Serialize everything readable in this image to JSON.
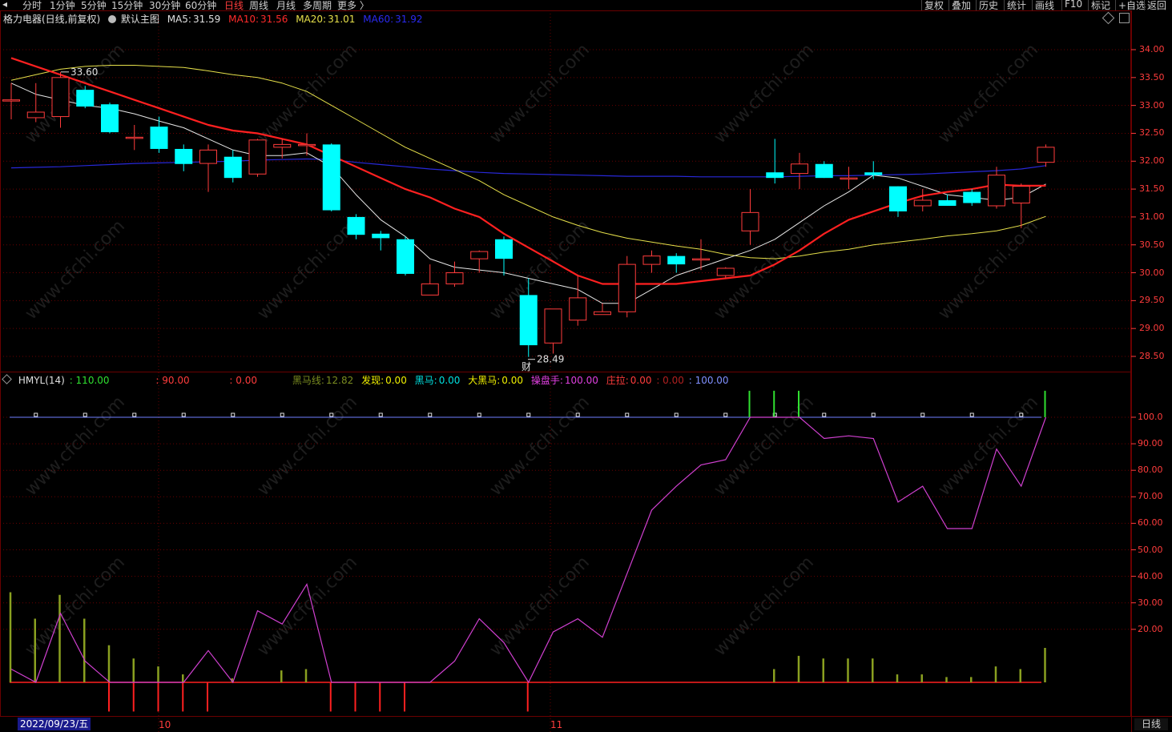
{
  "toolbar": {
    "periods": [
      "分时",
      "1分钟",
      "5分钟",
      "15分钟",
      "30分钟",
      "60分钟",
      "日线",
      "周线",
      "月线",
      "多周期",
      "更多 〉"
    ],
    "active_period": "日线",
    "right_buttons": [
      "复权",
      "叠加",
      "历史",
      "统计",
      "画线",
      "F10",
      "标记",
      "+自选",
      "返回"
    ]
  },
  "main_legend": {
    "title": "格力电器(日线,前复权)",
    "template": "默认主图",
    "ma5_label": "MA5:",
    "ma5_value": "31.59",
    "ma10_label": "MA10:",
    "ma10_value": "31.56",
    "ma20_label": "MA20:",
    "ma20_value": "31.01",
    "ma60_label": "MA60:",
    "ma60_value": "31.92"
  },
  "indicator_legend": {
    "name": "HMYL(14)",
    "v1": ": 110.00",
    "v2": ": 90.00",
    "v3": ": 0.00",
    "heima_line_label": "黑马线:",
    "heima_line_value": "12.82",
    "faxian_label": "发现:",
    "faxian_value": "0.00",
    "heima_label": "黑马:",
    "heima_value": "0.00",
    "daheima_label": "大黑马:",
    "daheima_value": "0.00",
    "caopan_label": "操盘手:",
    "caopan_value": "100.00",
    "zhuangla_label": "庄拉:",
    "zhuangla_value": "0.00",
    "v10": ": 0.00",
    "v11": ": 100.00"
  },
  "price_axis": [
    "34.00",
    "33.50",
    "33.00",
    "32.50",
    "32.00",
    "31.50",
    "31.00",
    "30.50",
    "30.00",
    "29.50",
    "29.00",
    "28.50"
  ],
  "ind_axis": [
    "100.0",
    "90.00",
    "80.00",
    "70.00",
    "60.00",
    "50.00",
    "40.00",
    "30.00",
    "20.00"
  ],
  "annotations": {
    "high": "33.60",
    "low": "28.49",
    "cai_marker": "财"
  },
  "date_axis": {
    "cursor_date": "2022/09/23/五",
    "month_10": "10",
    "month_11": "11",
    "period_btn": "日线"
  },
  "watermark": "www.cfchi.com",
  "colors": {
    "up": "#ff3c3c",
    "down": "#00ffff",
    "ma5": "#e6e6e6",
    "ma10": "#ff2020",
    "ma20": "#e6e04a",
    "ma60": "#2828d8",
    "ind_line": "#d040d0",
    "grid": "#6a0000"
  },
  "chart_data": {
    "type": "candlestick",
    "candles": [
      {
        "o": 33.1,
        "h": 33.4,
        "l": 32.75,
        "c": 33.1
      },
      {
        "o": 32.78,
        "h": 33.4,
        "l": 32.7,
        "c": 32.88
      },
      {
        "o": 32.8,
        "h": 33.6,
        "l": 32.6,
        "c": 33.5
      },
      {
        "o": 33.28,
        "h": 33.35,
        "l": 32.95,
        "c": 32.98
      },
      {
        "o": 33.02,
        "h": 33.05,
        "l": 32.5,
        "c": 32.52
      },
      {
        "o": 32.43,
        "h": 32.65,
        "l": 32.2,
        "c": 32.43
      },
      {
        "o": 32.62,
        "h": 32.8,
        "l": 32.15,
        "c": 32.22
      },
      {
        "o": 32.22,
        "h": 32.3,
        "l": 31.82,
        "c": 31.95
      },
      {
        "o": 31.96,
        "h": 32.3,
        "l": 31.45,
        "c": 32.2
      },
      {
        "o": 32.08,
        "h": 32.2,
        "l": 31.62,
        "c": 31.7
      },
      {
        "o": 31.77,
        "h": 32.4,
        "l": 31.72,
        "c": 32.38
      },
      {
        "o": 32.25,
        "h": 32.4,
        "l": 32.05,
        "c": 32.3
      },
      {
        "o": 32.3,
        "h": 32.5,
        "l": 32.1,
        "c": 32.3
      },
      {
        "o": 32.3,
        "h": 32.32,
        "l": 31.1,
        "c": 31.12
      },
      {
        "o": 31.0,
        "h": 31.05,
        "l": 30.6,
        "c": 30.68
      },
      {
        "o": 30.7,
        "h": 30.75,
        "l": 30.4,
        "c": 30.62
      },
      {
        "o": 30.6,
        "h": 30.65,
        "l": 29.95,
        "c": 29.98
      },
      {
        "o": 29.6,
        "h": 30.15,
        "l": 29.6,
        "c": 29.8
      },
      {
        "o": 29.8,
        "h": 30.2,
        "l": 29.75,
        "c": 30.0
      },
      {
        "o": 30.25,
        "h": 30.4,
        "l": 30.0,
        "c": 30.38
      },
      {
        "o": 30.6,
        "h": 30.65,
        "l": 29.95,
        "c": 30.25
      },
      {
        "o": 29.6,
        "h": 29.9,
        "l": 28.49,
        "c": 28.7
      },
      {
        "o": 28.74,
        "h": 29.35,
        "l": 28.55,
        "c": 29.35
      },
      {
        "o": 29.15,
        "h": 29.95,
        "l": 29.05,
        "c": 29.55
      },
      {
        "o": 29.25,
        "h": 29.45,
        "l": 29.25,
        "c": 29.3
      },
      {
        "o": 29.3,
        "h": 30.3,
        "l": 29.2,
        "c": 30.15
      },
      {
        "o": 30.15,
        "h": 30.4,
        "l": 30.0,
        "c": 30.3
      },
      {
        "o": 30.3,
        "h": 30.35,
        "l": 30.0,
        "c": 30.15
      },
      {
        "o": 30.25,
        "h": 30.6,
        "l": 30.05,
        "c": 30.25
      },
      {
        "o": 29.95,
        "h": 30.1,
        "l": 29.9,
        "c": 30.08
      },
      {
        "o": 30.75,
        "h": 31.5,
        "l": 30.5,
        "c": 31.08
      },
      {
        "o": 31.8,
        "h": 32.4,
        "l": 31.6,
        "c": 31.7
      },
      {
        "o": 31.78,
        "h": 32.15,
        "l": 31.5,
        "c": 31.95
      },
      {
        "o": 31.95,
        "h": 32.0,
        "l": 31.7,
        "c": 31.7
      },
      {
        "o": 31.68,
        "h": 31.9,
        "l": 31.5,
        "c": 31.7
      },
      {
        "o": 31.8,
        "h": 32.0,
        "l": 31.68,
        "c": 31.75
      },
      {
        "o": 31.55,
        "h": 31.55,
        "l": 31.0,
        "c": 31.1
      },
      {
        "o": 31.2,
        "h": 31.5,
        "l": 31.1,
        "c": 31.3
      },
      {
        "o": 31.3,
        "h": 31.4,
        "l": 31.2,
        "c": 31.2
      },
      {
        "o": 31.45,
        "h": 31.5,
        "l": 31.2,
        "c": 31.25
      },
      {
        "o": 31.2,
        "h": 31.9,
        "l": 31.15,
        "c": 31.75
      },
      {
        "o": 31.25,
        "h": 31.6,
        "l": 30.8,
        "c": 31.55
      },
      {
        "o": 31.98,
        "h": 32.3,
        "l": 31.9,
        "c": 32.25
      }
    ],
    "ma5": [
      33.4,
      33.2,
      33.1,
      33.0,
      32.95,
      32.85,
      32.72,
      32.6,
      32.4,
      32.2,
      32.1,
      32.1,
      32.15,
      31.9,
      31.4,
      30.95,
      30.65,
      30.25,
      30.1,
      30.05,
      30.0,
      29.9,
      29.8,
      29.7,
      29.45,
      29.45,
      29.7,
      29.95,
      30.1,
      30.25,
      30.4,
      30.6,
      30.9,
      31.2,
      31.45,
      31.75,
      31.7,
      31.55,
      31.4,
      31.35,
      31.3,
      31.35,
      31.59
    ],
    "ma10": [
      33.85,
      33.7,
      33.55,
      33.4,
      33.25,
      33.1,
      32.95,
      32.8,
      32.65,
      32.55,
      32.5,
      32.4,
      32.3,
      32.1,
      31.9,
      31.7,
      31.5,
      31.35,
      31.15,
      31.0,
      30.7,
      30.45,
      30.2,
      29.95,
      29.8,
      29.8,
      29.8,
      29.8,
      29.85,
      29.9,
      29.95,
      30.15,
      30.4,
      30.7,
      30.95,
      31.1,
      31.25,
      31.38,
      31.45,
      31.5,
      31.58,
      31.56,
      31.56
    ],
    "ma20": [
      33.45,
      33.55,
      33.65,
      33.7,
      33.72,
      33.72,
      33.7,
      33.68,
      33.62,
      33.55,
      33.5,
      33.4,
      33.25,
      33.0,
      32.75,
      32.5,
      32.25,
      32.05,
      31.85,
      31.65,
      31.4,
      31.2,
      31.0,
      30.85,
      30.72,
      30.62,
      30.55,
      30.48,
      30.42,
      30.33,
      30.27,
      30.25,
      30.3,
      30.37,
      30.42,
      30.5,
      30.55,
      30.6,
      30.66,
      30.7,
      30.75,
      30.85,
      31.01
    ],
    "ma60": [
      31.88,
      31.89,
      31.9,
      31.92,
      31.94,
      31.96,
      31.97,
      31.98,
      31.99,
      32.0,
      32.02,
      32.03,
      32.04,
      32.03,
      31.98,
      31.94,
      31.9,
      31.86,
      31.83,
      31.8,
      31.78,
      31.77,
      31.76,
      31.75,
      31.74,
      31.73,
      31.73,
      31.73,
      31.72,
      31.72,
      31.72,
      31.72,
      31.73,
      31.74,
      31.74,
      31.75,
      31.76,
      31.77,
      31.79,
      31.81,
      31.83,
      31.86,
      31.92
    ],
    "hmyl_line": [
      5,
      0,
      26,
      8,
      0,
      0,
      0,
      0,
      12,
      0,
      27,
      22,
      37,
      0,
      0,
      0,
      0,
      0,
      8,
      24,
      15,
      0,
      19,
      24,
      17,
      41,
      65,
      74,
      82,
      84,
      100,
      100,
      100,
      92,
      93,
      92,
      68,
      74,
      58,
      58,
      88,
      74,
      100
    ],
    "heima_bars": [
      34,
      24,
      33,
      24,
      14,
      9,
      6,
      3,
      0,
      1.5,
      0,
      4.5,
      5,
      0,
      0,
      0,
      0,
      0,
      0,
      0,
      0,
      0,
      0,
      0,
      0,
      0,
      0,
      0,
      0,
      0,
      0,
      5,
      10,
      9,
      9,
      9,
      3,
      3,
      2,
      2,
      6,
      5,
      13
    ],
    "zhuangla_bars": [
      0,
      0,
      0,
      0,
      -11,
      -11,
      -11,
      -11,
      -11,
      0,
      0,
      0,
      0,
      -11,
      -11,
      -11,
      -11,
      0,
      0,
      0,
      0,
      -11,
      0,
      0,
      0,
      0,
      0,
      0,
      0,
      0,
      0,
      0,
      0,
      0,
      0,
      0,
      0,
      0,
      0,
      0,
      0,
      0,
      0
    ],
    "caopan_flags": [
      0,
      0,
      0,
      0,
      0,
      0,
      0,
      0,
      0,
      0,
      0,
      0,
      0,
      0,
      0,
      0,
      0,
      0,
      0,
      0,
      0,
      0,
      0,
      0,
      0,
      0,
      0,
      0,
      0,
      0,
      1,
      1,
      1,
      0,
      0,
      0,
      0,
      0,
      0,
      0,
      0,
      0,
      1
    ],
    "price_range": [
      28.1,
      34.6
    ],
    "ind_range": [
      -12,
      122
    ]
  }
}
